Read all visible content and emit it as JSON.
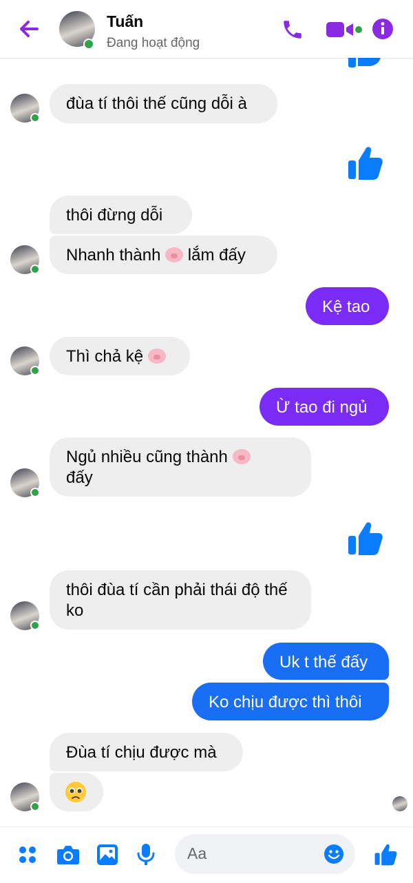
{
  "header": {
    "name": "Tuấn",
    "status": "Đang hoạt động",
    "icons": [
      "back-arrow-icon",
      "phone-icon",
      "video-camera-icon",
      "info-icon"
    ],
    "accent_color": "#8a2be2"
  },
  "messages": [
    {
      "sender": "them",
      "text": "đùa tí thôi thế cũng dỗi à"
    },
    {
      "sender": "me",
      "type": "like"
    },
    {
      "sender": "them",
      "text": "thôi đừng dỗi"
    },
    {
      "sender": "them",
      "text_before": "Nhanh thành",
      "emoji": "pig-face-emoji",
      "text_after": "lắm đấy"
    },
    {
      "sender": "me",
      "text": "Kệ tao"
    },
    {
      "sender": "them",
      "text_before": "Thì chả kệ",
      "emoji": "pig-face-emoji"
    },
    {
      "sender": "me",
      "text": "Ừ tao đi ngủ"
    },
    {
      "sender": "them",
      "text_before": "Ngủ nhiều cũng thành",
      "emoji": "pig-face-emoji",
      "text_after": "đấy"
    },
    {
      "sender": "me",
      "type": "like"
    },
    {
      "sender": "them",
      "text": "thôi đùa tí cần phải thái độ thế ko"
    },
    {
      "sender": "me",
      "text": "Uk t thế đấy"
    },
    {
      "sender": "me",
      "text": "Ko chịu được thì thôi"
    },
    {
      "sender": "them",
      "text": "Đùa tí chịu được mà"
    },
    {
      "sender": "them",
      "type": "emoji",
      "emoji": "pleading-face-emoji"
    }
  ],
  "composer": {
    "placeholder": "Aa",
    "icons": [
      "apps-grid-icon",
      "camera-icon",
      "image-icon",
      "microphone-icon",
      "emoji-icon",
      "like-icon"
    ]
  },
  "colors": {
    "outgoing_purple": "#7a2bf6",
    "outgoing_blue": "#1a6ef5",
    "incoming": "#eeeeef",
    "like_blue": "#0a7cff",
    "online": "#31a24c"
  }
}
